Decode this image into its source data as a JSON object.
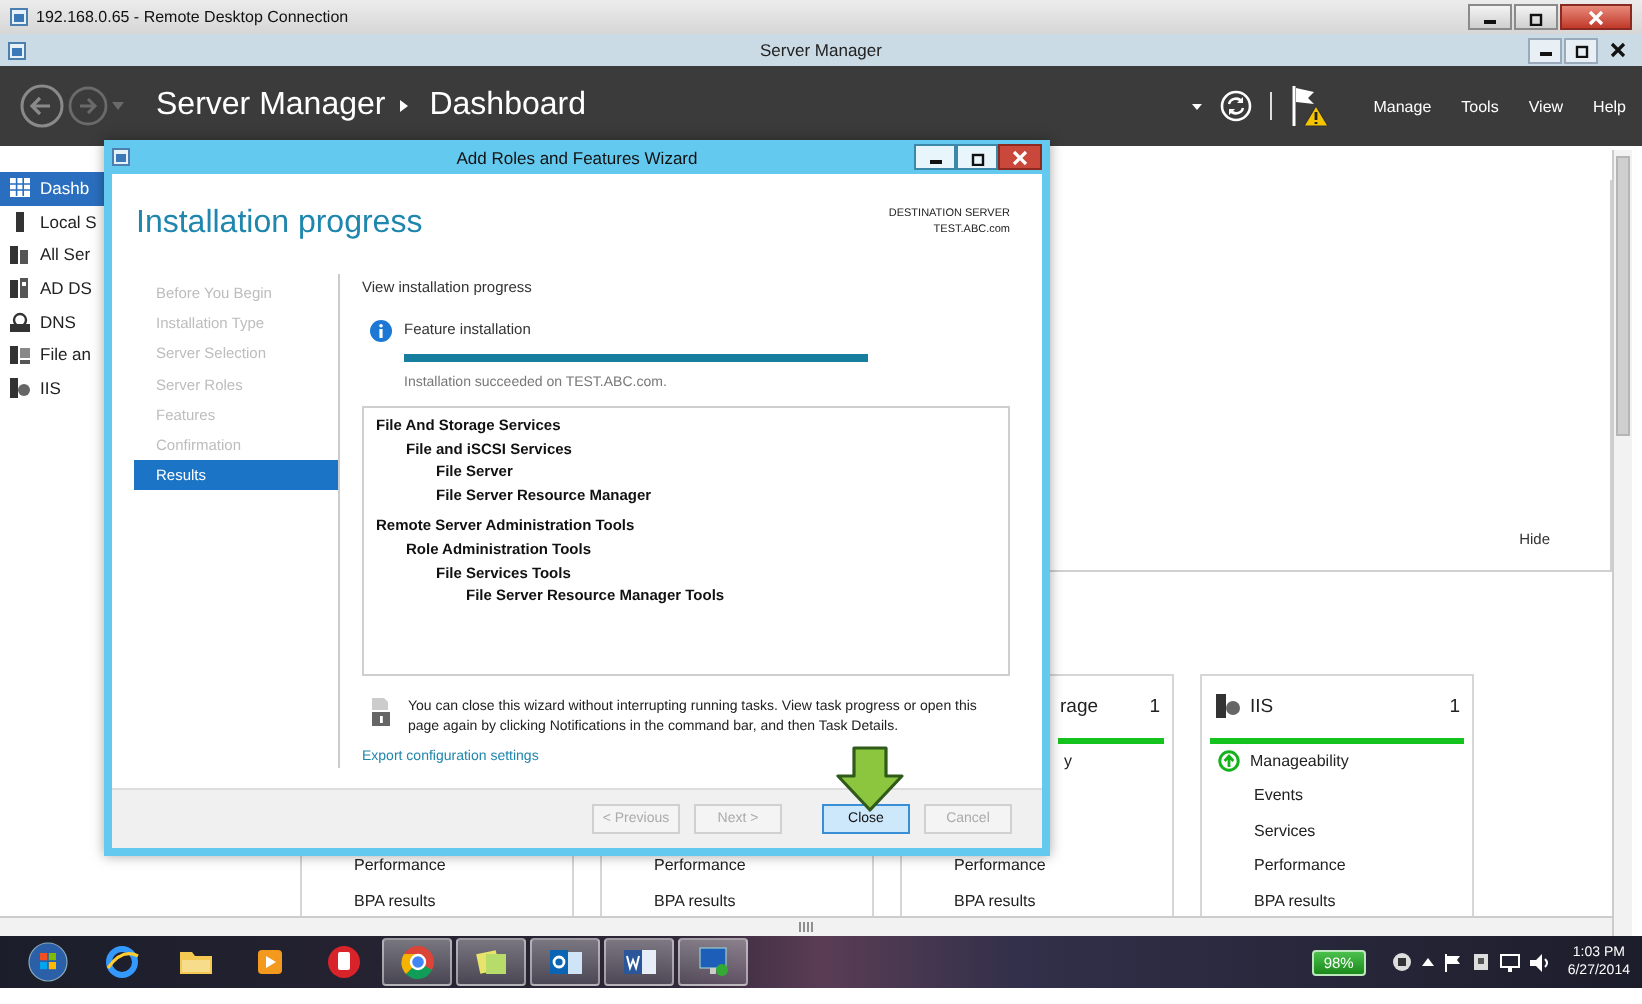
{
  "remote_desktop": {
    "title": "192.168.0.65 - Remote Desktop Connection"
  },
  "server_manager": {
    "title": "Server Manager",
    "breadcrumb": [
      "Server Manager",
      "Dashboard"
    ],
    "menu": [
      "Manage",
      "Tools",
      "View",
      "Help"
    ],
    "sidebar": {
      "items": [
        {
          "label": "Dashb",
          "selected": true
        },
        {
          "label": "Local S",
          "selected": false
        },
        {
          "label": "All Ser",
          "selected": false
        },
        {
          "label": "AD DS",
          "selected": false
        },
        {
          "label": "DNS",
          "selected": false
        },
        {
          "label": "File an",
          "selected": false
        },
        {
          "label": "IIS",
          "selected": false
        }
      ]
    },
    "welcome": {
      "hide": "Hide"
    },
    "tiles": [
      {
        "rows": [
          "Performance",
          "BPA results"
        ]
      },
      {
        "rows": [
          "Performance",
          "BPA results"
        ]
      },
      {
        "title": "rage",
        "count": "1",
        "manageability": "y",
        "rows": [
          "Performance",
          "BPA results"
        ]
      },
      {
        "title": "IIS",
        "count": "1",
        "manageability": "Manageability",
        "healthy": true,
        "rows": [
          "Events",
          "Services",
          "Performance",
          "BPA results"
        ]
      }
    ]
  },
  "wizard": {
    "title": "Add Roles and Features Wizard",
    "heading": "Installation progress",
    "destination_label": "DESTINATION SERVER",
    "destination": "TEST.ABC.com",
    "steps": [
      {
        "label": "Before You Begin",
        "selected": false
      },
      {
        "label": "Installation Type",
        "selected": false
      },
      {
        "label": "Server Selection",
        "selected": false
      },
      {
        "label": "Server Roles",
        "selected": false
      },
      {
        "label": "Features",
        "selected": false
      },
      {
        "label": "Confirmation",
        "selected": false
      },
      {
        "label": "Results",
        "selected": true
      }
    ],
    "section": "View installation progress",
    "task": "Feature installation",
    "progress": {
      "level": 1
    },
    "result": "Installation succeeded on TEST.ABC.com.",
    "features": [
      {
        "label": "File And Storage Services",
        "children": [
          {
            "label": "File and iSCSI Services",
            "children": [
              {
                "label": "File Server"
              },
              {
                "label": "File Server Resource Manager"
              }
            ]
          }
        ]
      },
      {
        "label": "Remote Server Administration Tools",
        "children": [
          {
            "label": "Role Administration Tools",
            "children": [
              {
                "label": "File Services Tools",
                "children": [
                  {
                    "label": "File Server Resource Manager Tools"
                  }
                ]
              }
            ]
          }
        ]
      }
    ],
    "note": "You can close this wizard without interrupting running tasks. View task progress or open this page again by clicking Notifications in the command bar, and then Task Details.",
    "export_link": "Export configuration settings",
    "buttons": [
      {
        "label": "< Previous",
        "disabled": true,
        "default": false
      },
      {
        "label": "Next >",
        "disabled": true,
        "default": false
      },
      {
        "label": "Close",
        "disabled": false,
        "default": true
      },
      {
        "label": "Cancel",
        "disabled": true,
        "default": false
      }
    ]
  },
  "taskbar": {
    "apps": [
      {
        "running": false
      },
      {
        "running": false
      },
      {
        "running": false
      },
      {
        "running": false
      },
      {
        "running": true
      },
      {
        "running": true
      },
      {
        "running": true
      },
      {
        "running": true
      },
      {
        "running": true
      }
    ],
    "battery": "98%",
    "time": "1:03 PM",
    "date": "6/27/2014"
  }
}
